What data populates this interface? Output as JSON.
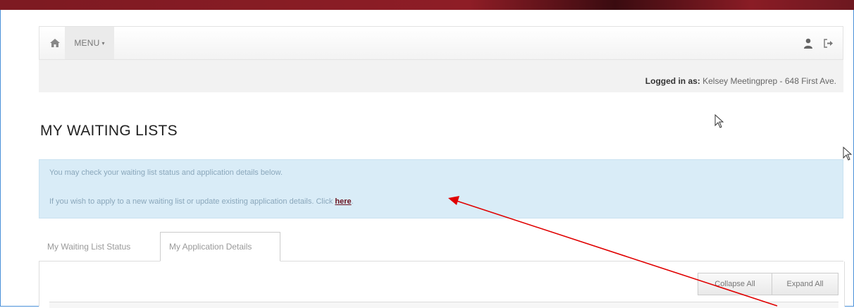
{
  "nav": {
    "menu_label": "MENU",
    "caret": "▾"
  },
  "login": {
    "label": "Logged in as:",
    "value": " Kelsey Meetingprep - 648 First Ave."
  },
  "page": {
    "title": "MY WAITING LISTS"
  },
  "info": {
    "line1": "You may check your waiting list status and application details below.",
    "line2_prefix": "If you wish to apply to a new waiting list or update existing application details. Click ",
    "link": "here",
    "line2_suffix": "."
  },
  "tabs": [
    {
      "label": "My Waiting List Status"
    },
    {
      "label": "My Application Details"
    }
  ],
  "buttons": {
    "collapse": "Collapse All",
    "expand": "Expand All"
  },
  "colors": {
    "brand_bar": "#8e1d26",
    "info_bg": "#d9ecf7",
    "link": "#6a1320",
    "annotation_arrow": "#e00000",
    "frame_border": "#4a90d9"
  },
  "icons": {
    "home": "home-icon",
    "user": "user-icon",
    "logout": "logout-icon"
  }
}
